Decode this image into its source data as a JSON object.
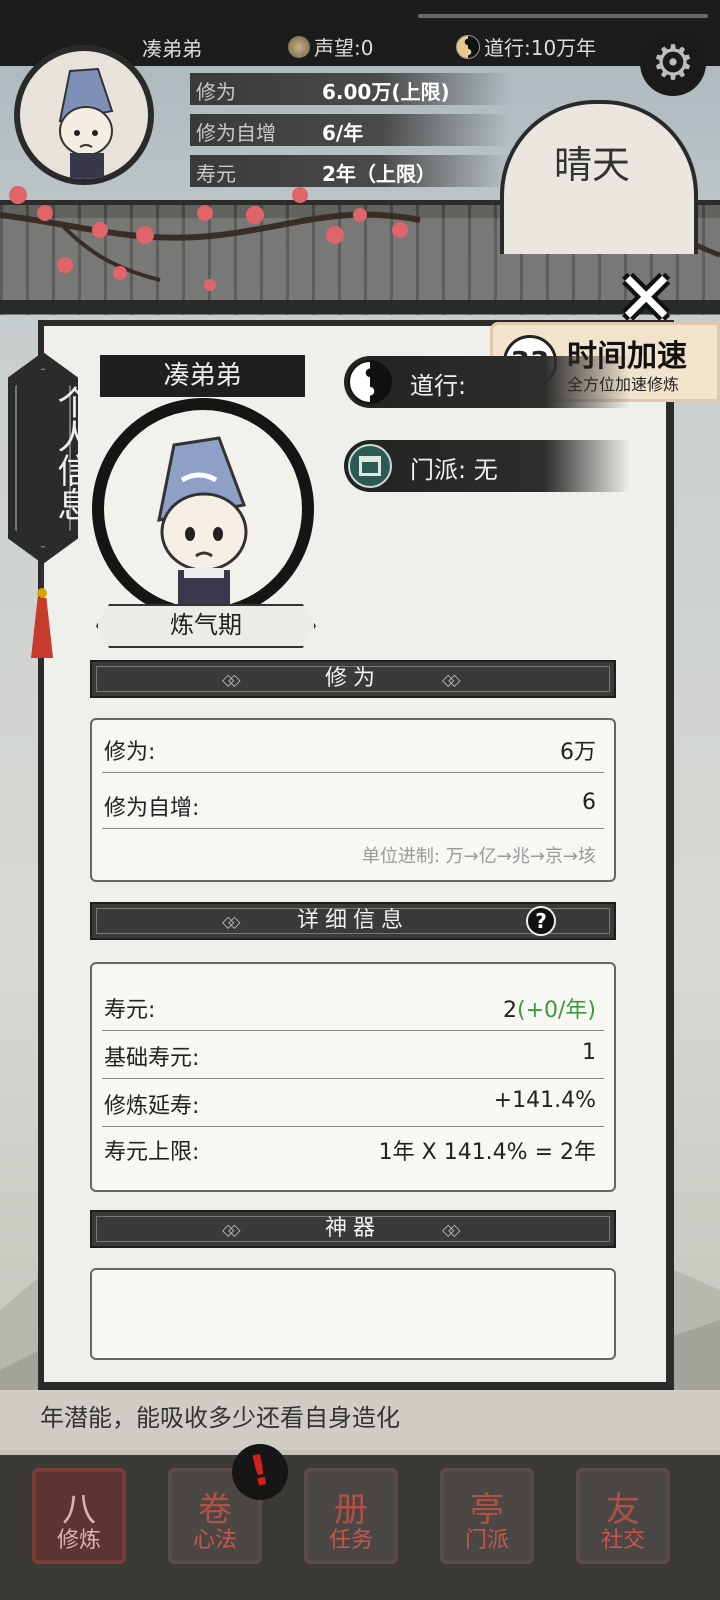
{
  "hud": {
    "player_name": "凑弟弟",
    "fame": "声望:0",
    "dao": "道行:10万年"
  },
  "top_stats": [
    {
      "label": "修为",
      "value": "6.00万(上限)"
    },
    {
      "label": "修为自增",
      "value": "6/年"
    },
    {
      "label": "寿元",
      "value": "2年（上限）"
    }
  ],
  "weather": "晴天",
  "side_tab": "个人信息",
  "speed_up": {
    "count": "33",
    "title": "时间加速",
    "subtitle": "全方位加速修炼"
  },
  "profile": {
    "name": "凑弟弟",
    "realm": "炼气期",
    "dao_label": "道行:",
    "sect": "门派: 无"
  },
  "cultivation": {
    "header": "修为",
    "rows": [
      {
        "key": "修为:",
        "value": "6万"
      },
      {
        "key": "修为自增:",
        "value": "6"
      }
    ],
    "unit_note": "单位进制: 万→亿→兆→京→垓"
  },
  "details": {
    "header": "详细信息",
    "help": "?",
    "rows": [
      {
        "key": "寿元:",
        "value": "2",
        "extra": "(+0/年)"
      },
      {
        "key": "基础寿元:",
        "value": "1"
      },
      {
        "key": "修炼延寿:",
        "value": "+141.4%"
      },
      {
        "key": "寿元上限:",
        "value": "1年 X 141.4% = 2年"
      }
    ]
  },
  "artifact": {
    "header": "神器"
  },
  "bottom_text": "年潜能，能吸收多少还看自身造化",
  "alert": "!",
  "nav": [
    {
      "label": "修炼",
      "glyph": "八"
    },
    {
      "label": "心法",
      "glyph": "卷"
    },
    {
      "label": "任务",
      "glyph": "册"
    },
    {
      "label": "门派",
      "glyph": "亭"
    },
    {
      "label": "社交",
      "glyph": "友"
    }
  ],
  "colors": {
    "accent_red": "#c63b2b",
    "green_gain": "#3c9a3c",
    "panel_dark": "#2b2b2b"
  }
}
